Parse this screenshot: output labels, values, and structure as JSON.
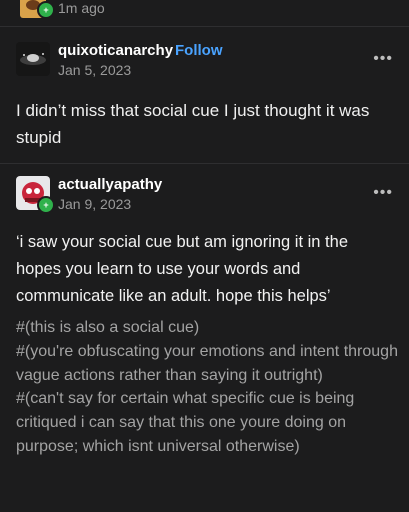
{
  "top": {
    "time": "1m ago"
  },
  "posts": [
    {
      "username": "quixoticanarchy",
      "follow_label": "Follow",
      "date": "Jan 5, 2023",
      "body": "I didn’t miss that social cue I just thought it was stupid"
    },
    {
      "username": "actuallyapathy",
      "date": "Jan 9, 2023",
      "quote": "‘i saw your social cue but am ignoring it in the hopes you learn to use your words and communicate like an adult.  hope this helps’",
      "tags": [
        "#(this is also a social cue)",
        "#(you're obfuscating your emotions and intent through vague actions rather than saying it outright)",
        "#(can't say for certain what specific cue is being critiqued i can say that this one youre doing on purpose; which isnt universal otherwise)"
      ]
    }
  ],
  "more_label": "•••",
  "icons": {
    "badge": "plus-badge-icon",
    "more": "more-options-icon"
  }
}
